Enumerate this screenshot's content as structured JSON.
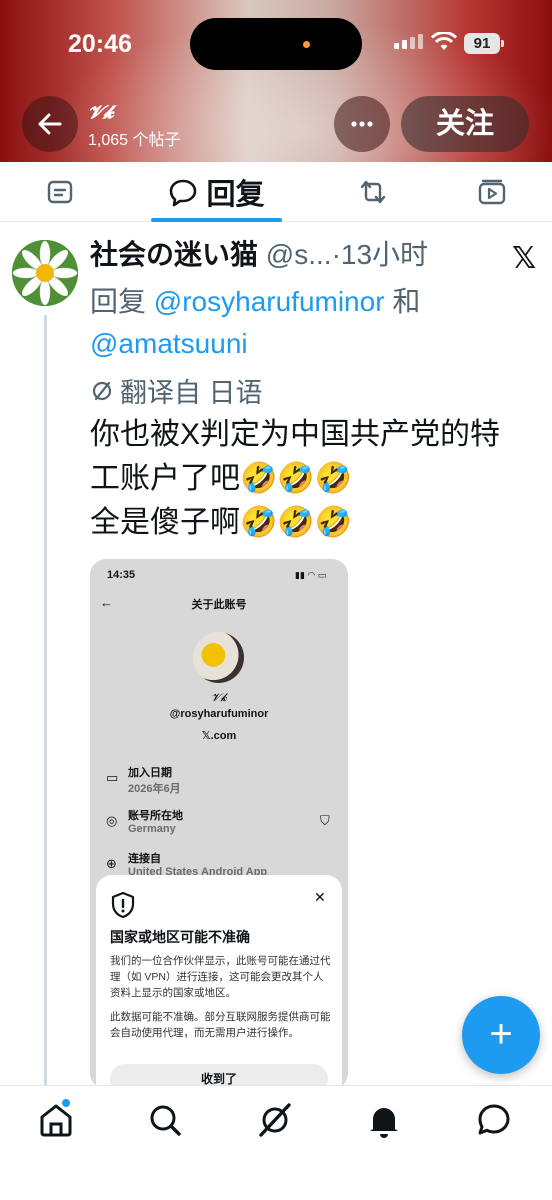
{
  "status_bar": {
    "time": "20:46",
    "battery": "91"
  },
  "header": {
    "account_name": "𝓥𝓴",
    "post_count": "1,065 个帖子",
    "follow_label": "关注",
    "more_icon": "ellipsis-icon",
    "back_icon": "arrow-left-icon"
  },
  "tabs": [
    {
      "icon": "article-icon",
      "label": ""
    },
    {
      "icon": "reply-bubble-icon",
      "label": "回复",
      "active": true
    },
    {
      "icon": "repost-icon",
      "label": ""
    },
    {
      "icon": "media-icon",
      "label": ""
    }
  ],
  "post": {
    "author_name": "社会の迷い猫",
    "author_handle": "@s...",
    "time_sep": "·",
    "time": "13小时",
    "source_logo": "𝕏",
    "reply_prefix": "回复",
    "mention_1": "@rosyharufuminor",
    "reply_and": "和",
    "mention_2": "@amatsuuni",
    "translated_label": "翻译自 日语",
    "body": "你也被X判定为中国共产党的特\n工账户了吧🤣🤣🤣\n全是傻子啊🤣🤣🤣"
  },
  "embedded": {
    "time": "14:35",
    "title": "关于此账号",
    "name": "𝓥𝓴",
    "handle": "@rosyharufuminor",
    "domain": "𝕏.com",
    "join_label": "加入日期",
    "join_value": "2026年6月",
    "location_label": "账号所在地",
    "location_value": "Germany",
    "connect_label": "连接自",
    "connect_value": "United States Android App",
    "sheet_title": "国家或地区可能不准确",
    "sheet_p1": "我们的一位合作伙伴显示，此账号可能在通过代理（如 VPN）进行连接，这可能会更改其个人资料上显示的国家或地区。",
    "sheet_p2": "此数据可能不准确。部分互联网服务提供商可能会自动使用代理，而无需用户进行操作。",
    "sheet_button": "收到了"
  },
  "fab_label": "+",
  "bottom_nav": [
    "home-icon",
    "search-icon",
    "grok-icon",
    "notifications-icon",
    "messages-icon"
  ],
  "colors": {
    "accent": "#1d9bf0",
    "text": "#0f1419",
    "muted": "#536471"
  }
}
